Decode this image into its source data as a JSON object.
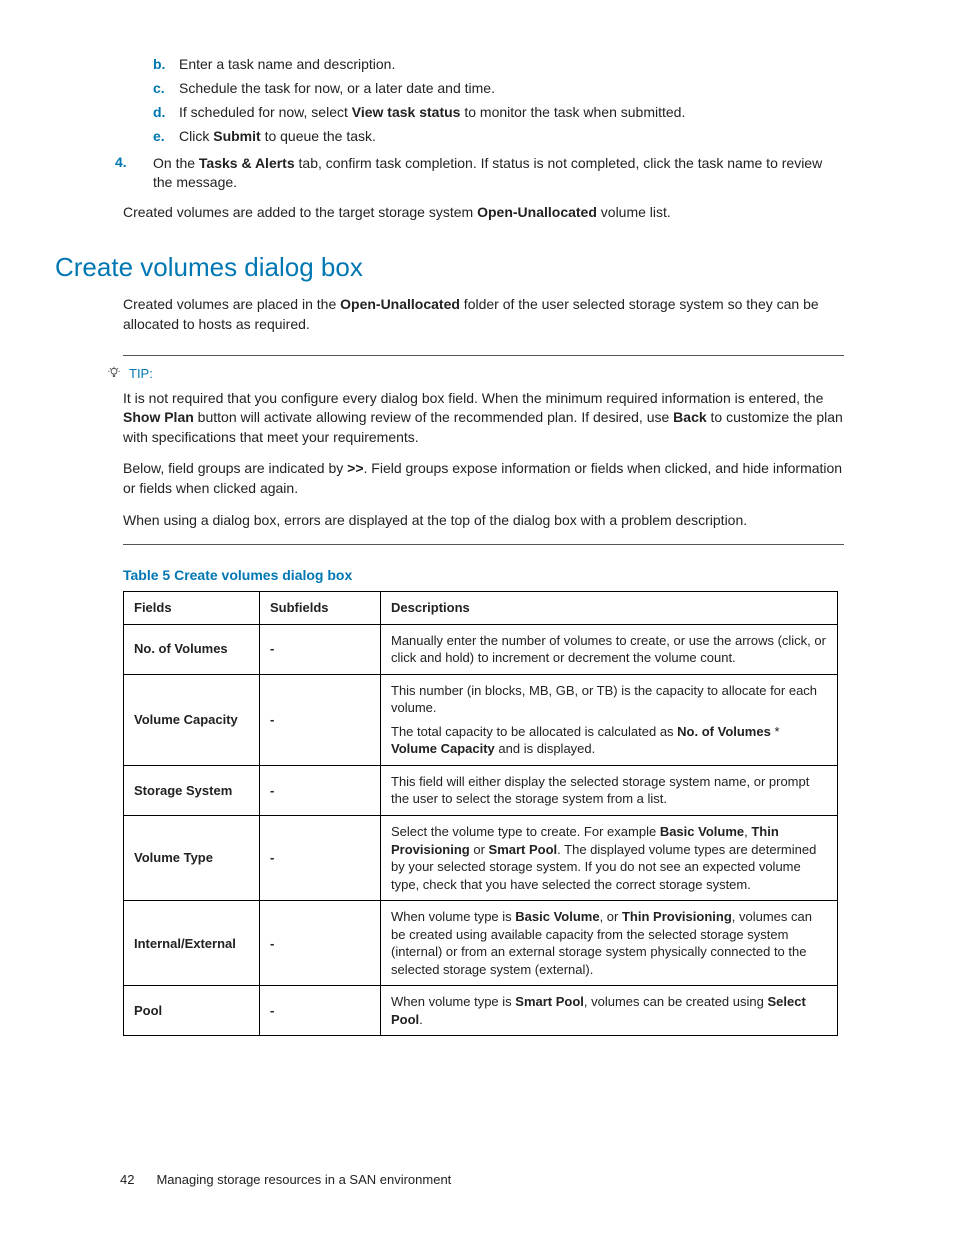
{
  "steps_letter": [
    {
      "marker": "b.",
      "html": "Enter a task name and description."
    },
    {
      "marker": "c.",
      "html": "Schedule the task for now, or a later date and time."
    },
    {
      "marker": "d.",
      "html": "If scheduled for now, select <b>View task status</b> to monitor the task when submitted."
    },
    {
      "marker": "e.",
      "html": "Click <b>Submit</b> to queue the task."
    }
  ],
  "steps_number": [
    {
      "marker": "4.",
      "html": "On the <b>Tasks &amp; Alerts</b> tab, confirm task completion. If status is not completed, click the task name to review the message."
    }
  ],
  "para_after_steps": "Created volumes are added to the target storage system <b>Open-Unallocated</b> volume list.",
  "section_heading": "Create volumes dialog box",
  "section_intro": "Created volumes are placed in the <b>Open-Unallocated</b> folder of the user selected storage system so they can be allocated to hosts as required.",
  "tip_label": "TIP:",
  "tip_paras": [
    "It is not required that you configure every dialog box field. When the minimum required information is entered, the <b>Show Plan</b> button will activate allowing review of the recommended plan. If desired, use <b>Back</b> to customize the plan with specifications that meet your requirements.",
    "Below, field groups are indicated by <b>&gt;&gt;</b>. Field groups expose information or fields when clicked, and hide information or fields when clicked again.",
    "When using a dialog box, errors are displayed at the top of the dialog box with a problem description."
  ],
  "table_title": "Table 5 Create volumes dialog box",
  "table_headers": [
    "Fields",
    "Subfields",
    "Descriptions"
  ],
  "table_rows": [
    {
      "field": "No. of Volumes",
      "subfield": "-",
      "desc": [
        "Manually enter the number of volumes to create, or use the arrows (click, or click and hold) to increment or decrement the volume count."
      ]
    },
    {
      "field": "Volume Capacity",
      "subfield": "-",
      "desc": [
        "This number (in blocks, MB, GB, or TB) is the capacity to allocate for each volume.",
        "The total capacity to be allocated is calculated as <b>No. of Volumes</b> * <b>Volume Capacity</b> and is displayed."
      ]
    },
    {
      "field": "Storage System",
      "subfield": "-",
      "desc": [
        "This field will either display the selected storage system name, or prompt the user to select the storage system from a list."
      ]
    },
    {
      "field": "Volume Type",
      "subfield": "-",
      "desc": [
        "Select the volume type to create. For example <b>Basic Volume</b>, <b>Thin Provisioning</b> or <b>Smart Pool</b>. The displayed volume types are determined by your selected storage system. If you do not see an expected volume type, check that you have selected the correct storage system."
      ]
    },
    {
      "field": "Internal/External",
      "subfield": "-",
      "desc": [
        "When volume type is <b>Basic Volume</b>, or <b>Thin Provisioning</b>, volumes can be created using available capacity from the selected storage system (internal) or from an external storage system physically connected to the selected storage system (external)."
      ]
    },
    {
      "field": "Pool",
      "subfield": "-",
      "desc": [
        "When volume type is <b>Smart Pool</b>, volumes can be created using <b>Select Pool</b>."
      ]
    }
  ],
  "footer_page": "42",
  "footer_text": "Managing storage resources in a SAN environment"
}
